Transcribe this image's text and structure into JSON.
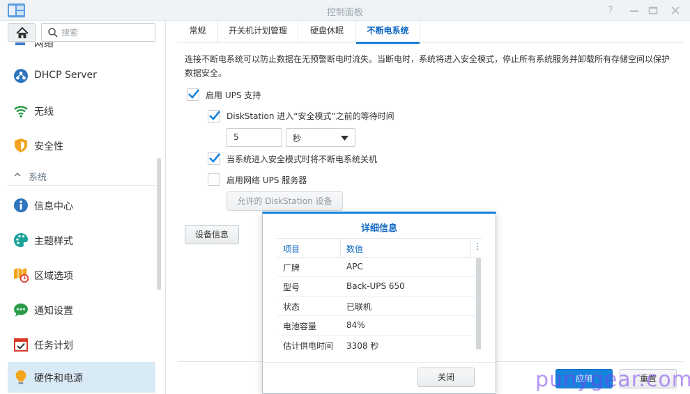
{
  "window": {
    "title": "控制面板"
  },
  "sidebar": {
    "search_placeholder": "搜索",
    "partial_item_label": "网络",
    "items_top": [
      {
        "label": "DHCP Server",
        "icon": "dhcp-server-icon"
      },
      {
        "label": "无线",
        "icon": "wifi-icon"
      },
      {
        "label": "安全性",
        "icon": "shield-icon"
      }
    ],
    "section_label": "系统",
    "items_system": [
      {
        "label": "信息中心",
        "icon": "info-icon"
      },
      {
        "label": "主题样式",
        "icon": "palette-icon"
      },
      {
        "label": "区域选项",
        "icon": "map-clock-icon"
      },
      {
        "label": "通知设置",
        "icon": "chat-bubble-icon"
      },
      {
        "label": "任务计划",
        "icon": "calendar-check-icon"
      },
      {
        "label": "硬件和电源",
        "icon": "lightbulb-icon"
      }
    ]
  },
  "tabs": [
    {
      "label": "常规"
    },
    {
      "label": "开关机计划管理"
    },
    {
      "label": "硬盘休眠"
    },
    {
      "label": "不断电系统"
    }
  ],
  "ups": {
    "description": "连接不断电系统可以防止数据在无预警断电时流失。当断电时，系统将进入安全模式，停止所有系统服务并卸载所有存储空间以保护数据安全。",
    "enable_ups": {
      "label": "启用 UPS 支持",
      "checked": true
    },
    "wait_time": {
      "label": "DiskStation 进入“安全模式”之前的等待时间",
      "checked": true,
      "value": "5",
      "unit": "秒"
    },
    "shutdown_ups": {
      "label": "当系统进入安全模式时将不断电系统关机",
      "checked": true
    },
    "network_ups": {
      "label": "启用网络 UPS 服务器",
      "checked": false
    },
    "allowed_ds_button": "允许的 DiskStation 设备",
    "device_info_button": "设备信息"
  },
  "footer": {
    "apply": "应用",
    "reset": "重置"
  },
  "modal": {
    "title": "详细信息",
    "columns": [
      "项目",
      "数值"
    ],
    "rows": [
      {
        "item": "厂牌",
        "value": "APC"
      },
      {
        "item": "型号",
        "value": "Back-UPS 650"
      },
      {
        "item": "状态",
        "value": "已联机"
      },
      {
        "item": "电池容量",
        "value": "84%"
      },
      {
        "item": "估计供电时间",
        "value": "3308 秒"
      }
    ],
    "close": "关闭"
  },
  "watermark": "punygear.com",
  "colors": {
    "accent": "#1683dd",
    "active_bg": "#d9eaf7",
    "titlebar_bg": "#f0f3f5"
  }
}
